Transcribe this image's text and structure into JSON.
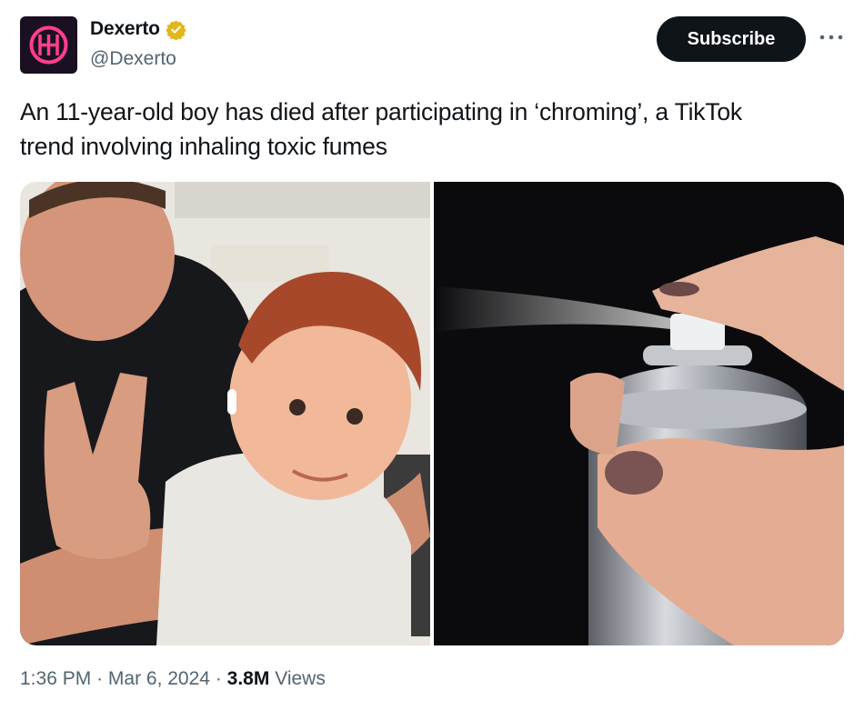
{
  "account": {
    "display_name": "Dexerto",
    "handle": "@Dexerto",
    "avatar_icon": "dexerto-logo-icon",
    "verified_icon": "verified-badge-icon",
    "verified_color": "#e2b719"
  },
  "actions": {
    "subscribe_label": "Subscribe",
    "more_icon": "more-options-icon"
  },
  "tweet": {
    "line1": "An 11-year-old boy has died after participating in ‘chroming’, a TikTok",
    "line2": "trend involving inhaling toxic fumes"
  },
  "media": {
    "photos": [
      {
        "depicts": "man and red-haired boy posing"
      },
      {
        "depicts": "hand pressing aerosol spray can"
      }
    ]
  },
  "meta": {
    "time": "1:36 PM",
    "separator": "·",
    "date": "Mar 6, 2024",
    "views_count": "3.8M",
    "views_label": "Views"
  },
  "colors": {
    "text_primary": "#0f1419",
    "text_secondary": "#536471",
    "button_bg": "#0f1419"
  }
}
